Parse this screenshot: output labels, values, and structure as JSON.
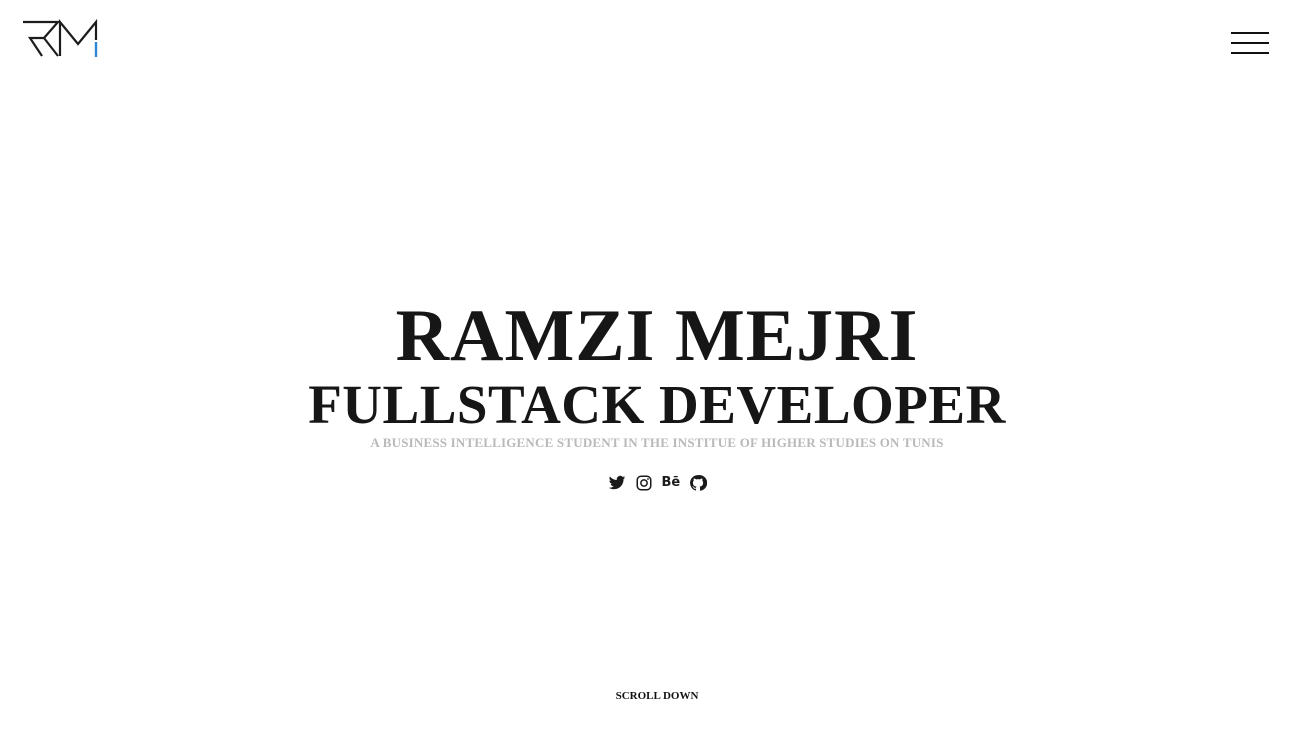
{
  "header": {
    "logo_alt": "RM",
    "accent_color": "#2f86d6",
    "menu_icon": "hamburger-menu-icon"
  },
  "hero": {
    "name": "RAMZI MEJRI",
    "role": "FULLSTACK DEVELOPER",
    "tagline": "A BUSINESS INTELLIGENCE STUDENT IN THE INSTITUE OF HIGHER STUDIES ON TUNIS"
  },
  "socials": [
    {
      "name": "twitter",
      "icon": "twitter-icon"
    },
    {
      "name": "instagram",
      "icon": "instagram-icon"
    },
    {
      "name": "behance",
      "icon": "behance-icon",
      "label": "Bē"
    },
    {
      "name": "github",
      "icon": "github-icon"
    }
  ],
  "footer": {
    "scroll_label": "SCROLL DOWN"
  }
}
